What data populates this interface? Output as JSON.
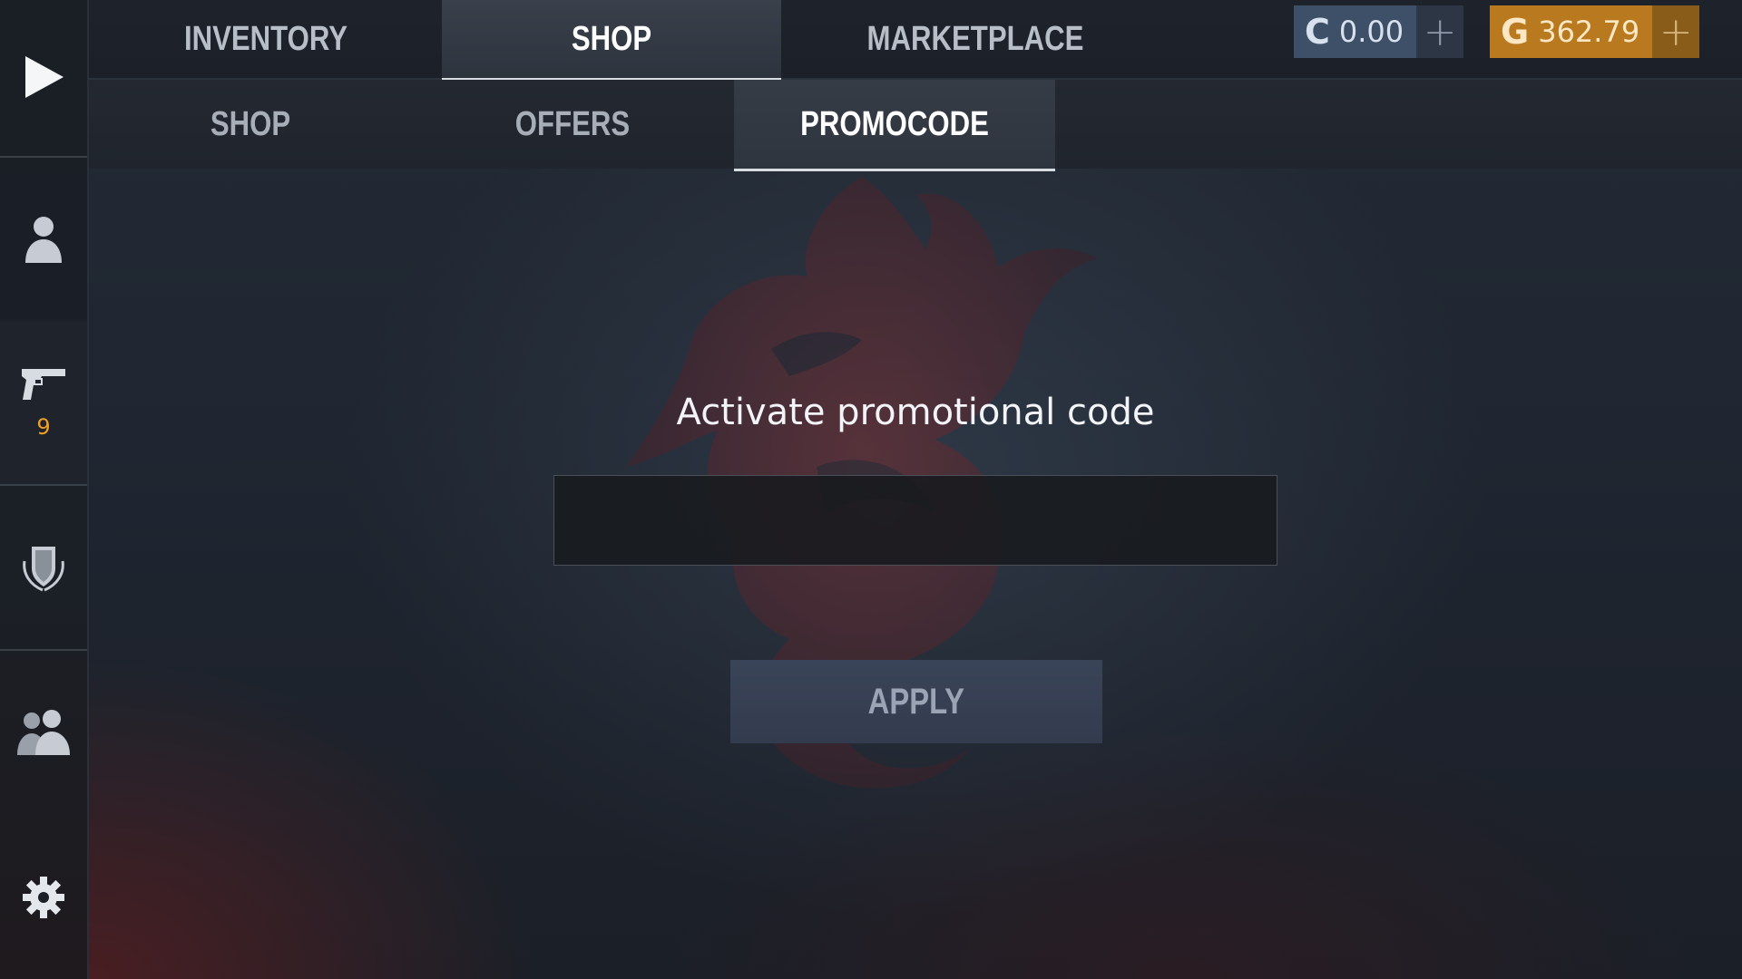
{
  "tabs": {
    "top": [
      {
        "label": "INVENTORY",
        "active": false
      },
      {
        "label": "SHOP",
        "active": true
      },
      {
        "label": "MARKETPLACE",
        "active": false
      }
    ],
    "sub": [
      {
        "label": "SHOP",
        "active": false
      },
      {
        "label": "OFFERS",
        "active": false
      },
      {
        "label": "PROMOCODE",
        "active": true
      }
    ]
  },
  "currency": {
    "silver": {
      "icon": "C",
      "amount": "0.00",
      "plus": "+"
    },
    "gold": {
      "icon": "G",
      "amount": "362.79",
      "plus": "+"
    }
  },
  "sidebar": {
    "items": [
      {
        "icon": "play-icon"
      },
      {
        "icon": "profile-icon"
      },
      {
        "icon": "pistol-icon",
        "count": "9"
      },
      {
        "icon": "clan-shield-icon"
      },
      {
        "icon": "friends-icon"
      },
      {
        "icon": "gear-icon"
      }
    ]
  },
  "promo": {
    "title": "Activate promotional code",
    "input_value": "",
    "apply_label": "APPLY"
  },
  "colors": {
    "accent_gold": "#b97a1f",
    "accent_silver": "#3e4f68",
    "count_orange": "#f0a020"
  }
}
